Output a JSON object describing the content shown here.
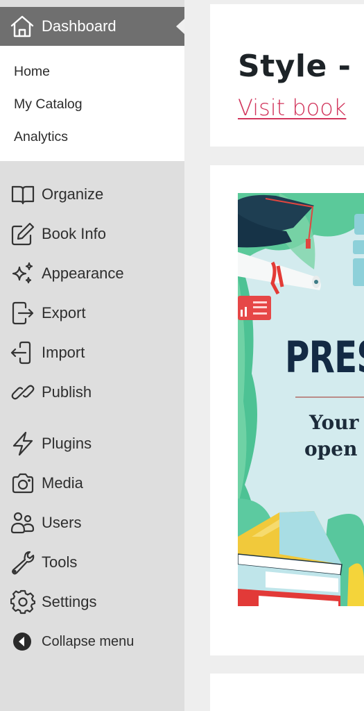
{
  "sidebar": {
    "dashboard": {
      "label": "Dashboard",
      "icon": "home-icon"
    },
    "submenu": [
      {
        "label": "Home"
      },
      {
        "label": "My Catalog"
      },
      {
        "label": "Analytics"
      }
    ],
    "items": [
      {
        "label": "Organize",
        "icon": "book-open-icon"
      },
      {
        "label": "Book Info",
        "icon": "edit-pencil-icon"
      },
      {
        "label": "Appearance",
        "icon": "sparkles-icon"
      },
      {
        "label": "Export",
        "icon": "export-icon"
      },
      {
        "label": "Import",
        "icon": "import-icon"
      },
      {
        "label": "Publish",
        "icon": "link-icon"
      },
      {
        "label": "Plugins",
        "icon": "lightning-icon"
      },
      {
        "label": "Media",
        "icon": "camera-icon"
      },
      {
        "label": "Users",
        "icon": "users-icon"
      },
      {
        "label": "Tools",
        "icon": "wrench-icon"
      },
      {
        "label": "Settings",
        "icon": "gear-icon"
      }
    ],
    "collapse": {
      "label": "Collapse menu",
      "icon": "collapse-arrow-icon"
    }
  },
  "main": {
    "title": "Style - U",
    "visit_link": "Visit book",
    "cover": {
      "title": "PRES",
      "line1": "Your",
      "line2": "open"
    }
  },
  "colors": {
    "accent_link": "#d1345b",
    "dashboard_bg": "#6f6f6f",
    "sidebar_bg": "#dedede"
  }
}
